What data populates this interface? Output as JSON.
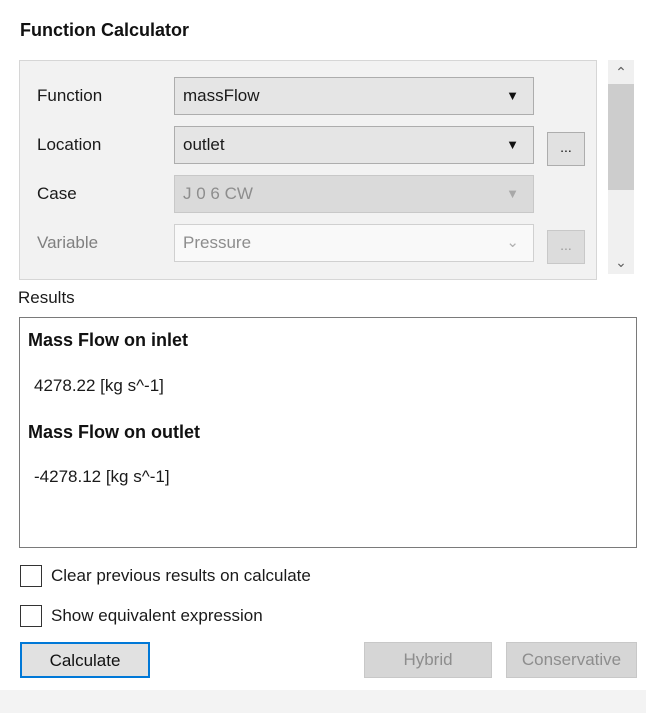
{
  "panel": {
    "title": "Function Calculator"
  },
  "form": {
    "function": {
      "label": "Function",
      "value": "massFlow"
    },
    "location": {
      "label": "Location",
      "value": "outlet",
      "browse_label": "..."
    },
    "case": {
      "label": "Case",
      "value": "J 0 6 CW"
    },
    "variable": {
      "label": "Variable",
      "value": "Pressure",
      "browse_label": "..."
    }
  },
  "results": {
    "label": "Results",
    "entries": [
      {
        "heading": "Mass Flow on inlet",
        "value": "4278.22 [kg s^-1]"
      },
      {
        "heading": "Mass Flow on outlet",
        "value": "-4278.12 [kg s^-1]"
      }
    ]
  },
  "options": {
    "clear_previous": {
      "label": "Clear previous results on calculate",
      "checked": false
    },
    "show_expression": {
      "label": "Show equivalent expression",
      "checked": false
    }
  },
  "buttons": {
    "calculate": "Calculate",
    "hybrid": "Hybrid",
    "conservative": "Conservative"
  },
  "icons": {
    "dropdown_arrow": "triangle-down",
    "scroll_up": "chevron-up",
    "scroll_down": "chevron-down"
  }
}
